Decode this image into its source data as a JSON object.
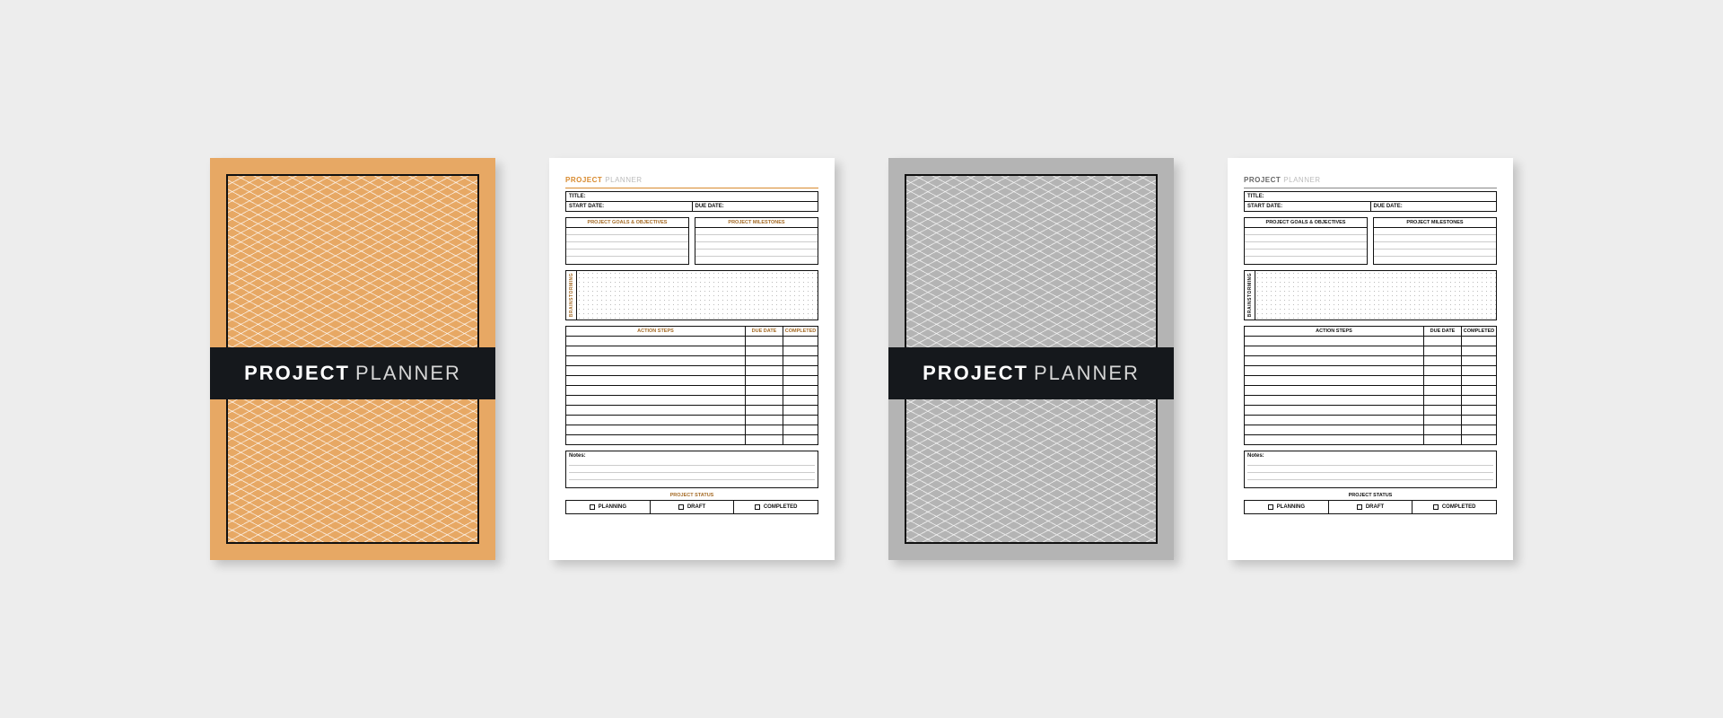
{
  "cover": {
    "title_bold": "PROJECT",
    "title_light": "PLANNER"
  },
  "sheet": {
    "heading_bold": "PROJECT",
    "heading_light": "PLANNER",
    "title_label": "TITLE:",
    "start_label": "START DATE:",
    "due_label": "DUE DATE:",
    "goals_header": "PROJECT GOALS & OBJECTIVES",
    "milestones_header": "PROJECT MILESTONES",
    "brainstorming_label": "BRAINSTORMING",
    "action_header": "ACTION STEPS",
    "action_due": "DUE DATE",
    "action_completed": "COMPLETED",
    "notes_label": "Notes:",
    "status_header": "PROJECT STATUS",
    "status_planning": "PLANNING",
    "status_draft": "DRAFT",
    "status_completed": "COMPLETED"
  }
}
